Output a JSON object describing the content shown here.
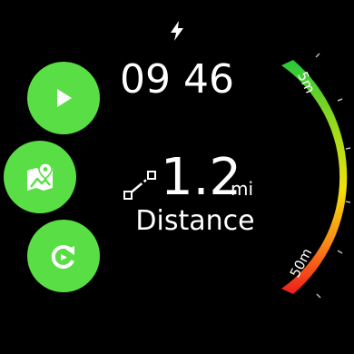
{
  "status": {
    "charging_icon": "bolt-icon"
  },
  "clock": {
    "time": "09 46"
  },
  "actions": [
    {
      "name": "play-button",
      "icon": "play-icon"
    },
    {
      "name": "map-button",
      "icon": "map-pin-icon"
    },
    {
      "name": "sync-button",
      "icon": "refresh-icon"
    }
  ],
  "metric": {
    "value": "1.2",
    "unit": "mi",
    "label": "Distance",
    "icon": "route-icon"
  },
  "gauge": {
    "top_label": "5m",
    "bottom_label": "50m",
    "colors": {
      "top": "#27c83a",
      "upper_mid": "#9edb1a",
      "middle": "#f2e20c",
      "lower_mid": "#fb8a14",
      "bottom": "#ee1c1c"
    }
  },
  "theme": {
    "accent": "#5ade45",
    "background": "#000000",
    "text": "#ffffff"
  }
}
